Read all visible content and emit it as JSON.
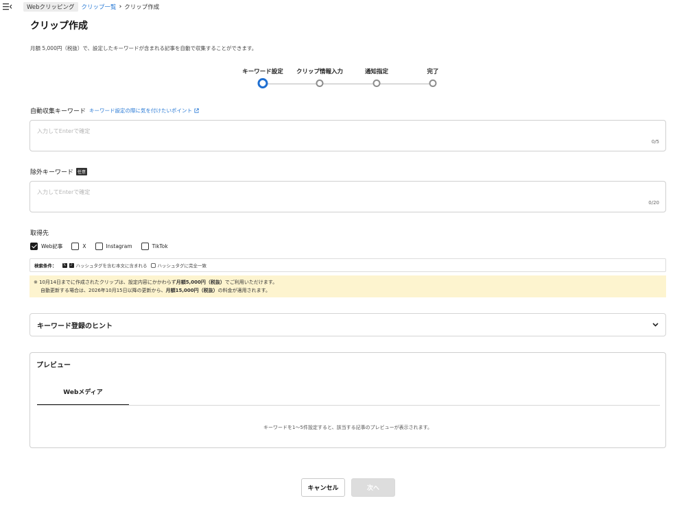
{
  "breadcrumb": {
    "root": "Webクリッピング",
    "parent": "クリップ一覧",
    "current": "クリップ作成"
  },
  "page": {
    "title": "クリップ作成",
    "description": "月額 5,000円（税抜）で、設定したキーワードが含まれる記事を自動で収集することができます。"
  },
  "stepper": {
    "steps": [
      {
        "label": "キーワード設定",
        "active": true
      },
      {
        "label": "クリップ情報入力",
        "active": false
      },
      {
        "label": "通知指定",
        "active": false
      },
      {
        "label": "完了",
        "active": false
      }
    ]
  },
  "keywords": {
    "label": "自動収集キーワード",
    "hint_link": "キーワード設定の際に気を付けたいポイント",
    "placeholder": "入力してEnterで確定",
    "count": "0/5"
  },
  "exclude": {
    "label": "除外キーワード",
    "badge": "任意",
    "placeholder": "入力してEnterで確定",
    "count": "0/20"
  },
  "sources": {
    "label": "取得先",
    "items": [
      {
        "label": "Web記事",
        "checked": true
      },
      {
        "label": "X",
        "checked": false
      },
      {
        "label": "Instagram",
        "checked": false
      },
      {
        "label": "TikTok",
        "checked": false
      }
    ]
  },
  "search_condition": {
    "label": "検索条件：",
    "rule1": "ハッシュタグを含む本文に含まれる",
    "rule2": "ハッシュタグに完全一致"
  },
  "notice": {
    "prefix": "※ 10月14日までに作成されたクリップは、設定内容にかかわらず",
    "price_bold": "月額5,000円（税抜）",
    "suffix": "でご利用いただけます。",
    "line2_prefix": "自動更新する場合は、2026年10月15日以降の更新から、",
    "line2_bold": "月額15,000円（税抜）",
    "line2_suffix": "の料金が適用されます。"
  },
  "hints": {
    "title": "キーワード登録のヒント"
  },
  "preview": {
    "title": "プレビュー",
    "tab": "Webメディア",
    "empty_message": "キーワードを1～5件設定すると、該当する記事のプレビューが表示されます。"
  },
  "actions": {
    "cancel": "キャンセル",
    "next": "次へ"
  },
  "colors": {
    "accent": "#1f6fd1",
    "link": "#2b7bd6",
    "notice_bg": "#fdf4cf"
  }
}
